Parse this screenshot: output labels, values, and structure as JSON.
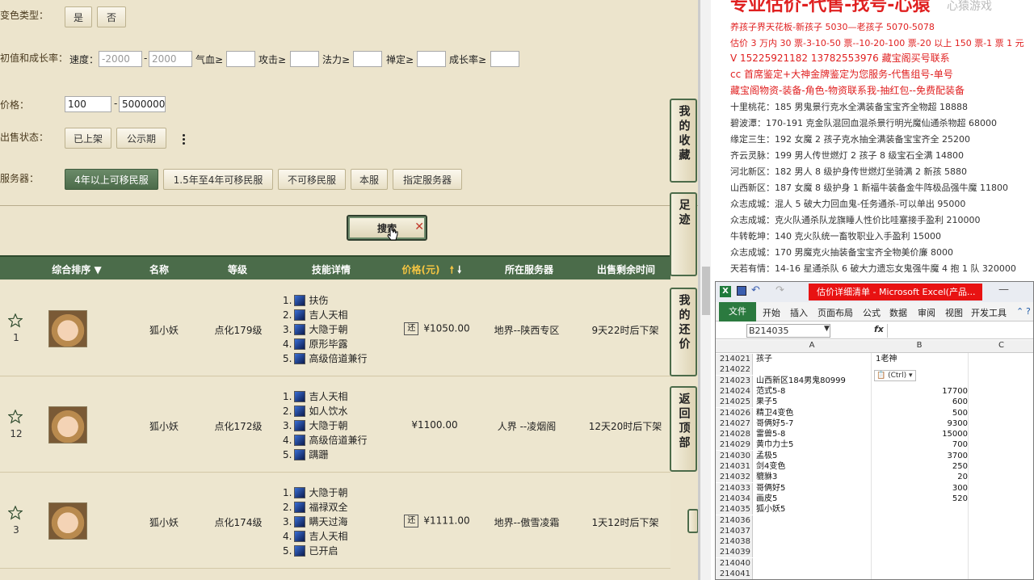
{
  "filters": {
    "variant_type": {
      "label": "变色类型：",
      "options": [
        "是",
        "否"
      ]
    },
    "stats": {
      "label": "初值和成长率：",
      "speed_label": "速度：",
      "speed_min": "-2000",
      "speed_max": "2000",
      "fields": [
        "气血≥",
        "攻击≥",
        "法力≥",
        "禅定≥",
        "成长率≥"
      ]
    },
    "price": {
      "label": "价格：",
      "min": "100",
      "max": "5000000"
    },
    "sale_status": {
      "label": "出售状态：",
      "options": [
        "已上架",
        "公示期"
      ]
    },
    "server": {
      "label": "服务器：",
      "options": [
        "4年以上可移民服",
        "1.5年至4年可移民服",
        "不可移民服",
        "本服",
        "指定服务器"
      ]
    }
  },
  "search": {
    "label": "搜索"
  },
  "table": {
    "headers": [
      "综合排序",
      "名称",
      "等级",
      "技能详情",
      "价格(元)",
      "所在服务器",
      "出售剩余时间"
    ],
    "rows": [
      {
        "rank": "1",
        "name": "狐小妖",
        "level": "点化179级",
        "skills": [
          "1. 扶伤",
          "2. 吉人天相",
          "3. 大隐于朝",
          "4. 原形毕露",
          "5. 高级倍道兼行"
        ],
        "huan": "还",
        "price": "¥1050.00",
        "server": "地界--陕西专区",
        "remaining": "9天22时后下架"
      },
      {
        "rank": "12",
        "name": "狐小妖",
        "level": "点化172级",
        "skills": [
          "1. 吉人天相",
          "2. 如人饮水",
          "3. 大隐于朝",
          "4. 高级倍道兼行",
          "5. 蹒跚"
        ],
        "huan": "",
        "price": "¥1100.00",
        "server": "人界 --凌烟阁",
        "remaining": "12天20时后下架"
      },
      {
        "rank": "3",
        "name": "狐小妖",
        "level": "点化174级",
        "skills": [
          "1. 大隐于朝",
          "2. 福禄双全",
          "3. 瞒天过海",
          "4. 吉人天相",
          "5. 已开启"
        ],
        "huan": "还",
        "price": "¥1111.00",
        "server": "地界--傲雪凌霜",
        "remaining": "1天12时后下架"
      }
    ]
  },
  "side_buttons": [
    "我的收藏",
    "足迹",
    "我的还价",
    "返回顶部"
  ],
  "document": {
    "title": "专业估价-代售-找号-心猿",
    "lines_red": [
      "养孩子界天花板-新孩子 5030—老孩子 5070-5078",
      "估价 3 万内 30 票-3-10-50 票--10-20-100 票-20 以上 150 票-1 票 1 元",
      "V 15225921182      13782553976    藏宝阁买号联系",
      "cc 首席鉴定+大神金牌鉴定为您服务-代售组号-单号",
      "藏宝阁物资-装备-角色-物资联系我-抽红包--免费配装备"
    ],
    "lines_black": [
      "十里桃花：185 男鬼景行克水全满装备宝宝齐全物超 18888",
      "碧波潭：170-191 克金队混回血混杀景行明光魔仙通杀物超 68000",
      "缘定三生：192 女魔 2 孩子克水抽全满装备宝宝齐全 25200",
      "齐云灵脉：199 男人传世燃灯 2 孩子 8 级宝石全满 14800",
      "河北新区：182 男人 8 级护身传世燃灯坐骑满 2 新孩 5880",
      "山西新区：187 女魔 8 级护身 1 新福牛装备金牛阵极品强牛魔 11800",
      "众志成城：混人 5 破大力回血鬼-任务通杀-可以单出 95000",
      "众志成城：克火队通杀队龙旗睡人性价比哇塞接手盈利 210000",
      "牛转乾坤：140 克火队统一畜牧职业入手盈利 15000",
      "众志成城：170 男魔克火抽装备宝宝齐全物美价廉 8000",
      "天若有情：14-16 星通杀队 6 破大力遗忘女鬼强牛魔 4 抱 1 队 320000"
    ],
    "watermark": "心猿游戏"
  },
  "excel": {
    "title": "估价详细清单 - Microsoft Excel(产品...",
    "tabs": [
      "文件",
      "开始",
      "插入",
      "页面布局",
      "公式",
      "数据",
      "审阅",
      "视图",
      "开发工具"
    ],
    "namebox": "B214035",
    "fx": "fx",
    "columns": [
      "A",
      "B",
      "C"
    ],
    "paste_hint": "(Ctrl)",
    "rows": [
      {
        "num": "214021",
        "a": "孩子",
        "b": "1老神",
        "b_left": true
      },
      {
        "num": "214022",
        "a": "",
        "b": ""
      },
      {
        "num": "214023",
        "a": "山西新区184男鬼80999",
        "b": ""
      },
      {
        "num": "214024",
        "a": "范式5-8",
        "b": "17700"
      },
      {
        "num": "214025",
        "a": "果子5",
        "b": "600"
      },
      {
        "num": "214026",
        "a": "精卫4变色",
        "b": "500"
      },
      {
        "num": "214027",
        "a": "哥俩好5-7",
        "b": "9300"
      },
      {
        "num": "214028",
        "a": "雷兽5-8",
        "b": "15000"
      },
      {
        "num": "214029",
        "a": "黄巾力士5",
        "b": "700"
      },
      {
        "num": "214030",
        "a": "孟极5",
        "b": "3700"
      },
      {
        "num": "214031",
        "a": "剑4变色",
        "b": "250"
      },
      {
        "num": "214032",
        "a": "貔貅3",
        "b": "20"
      },
      {
        "num": "214033",
        "a": "哥俩好5",
        "b": "300"
      },
      {
        "num": "214034",
        "a": "画皮5",
        "b": "520"
      },
      {
        "num": "214035",
        "a": "狐小妖5",
        "b": ""
      },
      {
        "num": "214036",
        "a": "",
        "b": ""
      },
      {
        "num": "214037",
        "a": "",
        "b": ""
      },
      {
        "num": "214038",
        "a": "",
        "b": ""
      },
      {
        "num": "214039",
        "a": "",
        "b": ""
      },
      {
        "num": "214040",
        "a": "",
        "b": ""
      },
      {
        "num": "214041",
        "a": "",
        "b": ""
      }
    ]
  },
  "colors": {
    "accent_green": "#4b6c4a",
    "panel_bg": "#ece4cc",
    "red_text": "#e02020",
    "excel_green": "#2b7a3f"
  }
}
